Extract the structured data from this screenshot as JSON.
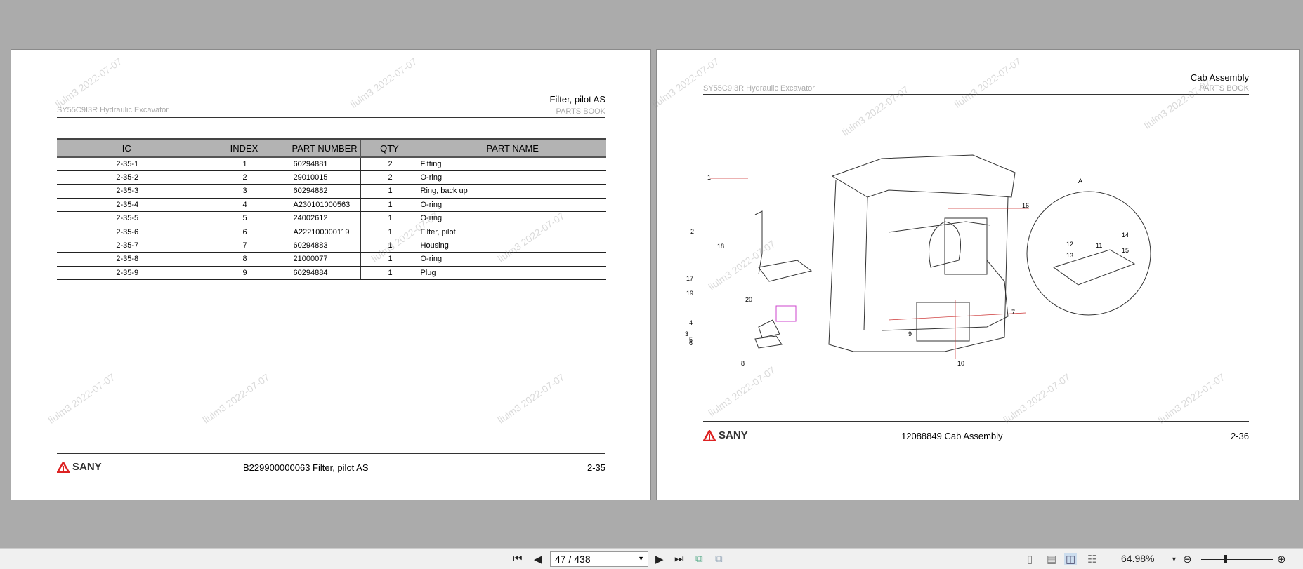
{
  "watermark": "liulm3 2022-07-07",
  "left_page": {
    "model": "SY55C9I3R Hydraulic Excavator",
    "title": "Filter, pilot AS",
    "subtitle": "PARTS BOOK",
    "columns": [
      "IC",
      "INDEX",
      "PART NUMBER",
      "QTY",
      "PART NAME"
    ],
    "rows": [
      [
        "2-35-1",
        "1",
        "60294881",
        "2",
        "Fitting"
      ],
      [
        "2-35-2",
        "2",
        "29010015",
        "2",
        "O-ring"
      ],
      [
        "2-35-3",
        "3",
        "60294882",
        "1",
        "Ring, back up"
      ],
      [
        "2-35-4",
        "4",
        "A230101000563",
        "1",
        "O-ring"
      ],
      [
        "2-35-5",
        "5",
        "24002612",
        "1",
        "O-ring"
      ],
      [
        "2-35-6",
        "6",
        "A222100000119",
        "1",
        "Filter, pilot"
      ],
      [
        "2-35-7",
        "7",
        "60294883",
        "1",
        "Housing"
      ],
      [
        "2-35-8",
        "8",
        "21000077",
        "1",
        "O-ring"
      ],
      [
        "2-35-9",
        "9",
        "60294884",
        "1",
        "Plug"
      ]
    ],
    "logo": "SANY",
    "footer": "B229900000063 Filter, pilot AS",
    "page_no": "2-35"
  },
  "right_page": {
    "model": "SY55C9I3R Hydraulic Excavator",
    "title": "Cab Assembly",
    "subtitle": "PARTS BOOK",
    "detail_label": "A",
    "callouts": [
      "1",
      "2",
      "3",
      "4",
      "5",
      "6",
      "7",
      "8",
      "9",
      "10",
      "11",
      "12",
      "13",
      "14",
      "15",
      "16",
      "17",
      "18",
      "19",
      "20"
    ],
    "logo": "SANY",
    "footer": "12088849 Cab Assembly",
    "page_no": "2-36"
  },
  "toolbar": {
    "page_input": "47 / 438",
    "zoom": "64.98%",
    "zoom_level_percent": 64.98
  }
}
